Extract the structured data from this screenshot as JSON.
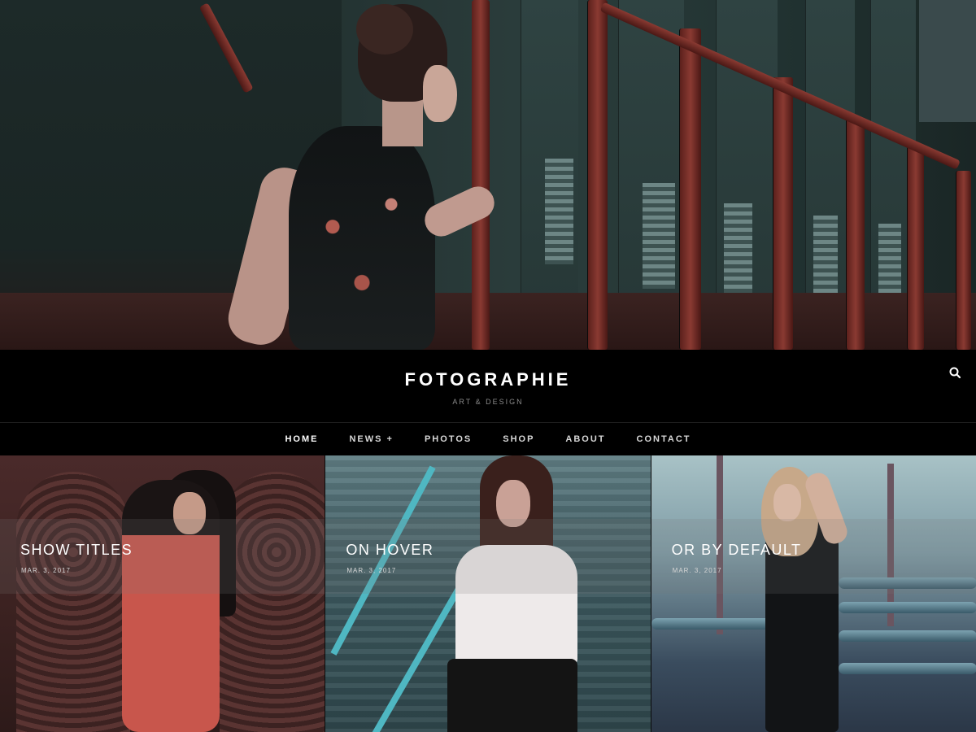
{
  "site": {
    "title": "FOTOGRAPHIE",
    "tagline": "ART & DESIGN"
  },
  "header": {
    "search_icon": "search-icon"
  },
  "nav": {
    "items": [
      {
        "label": "HOME",
        "active": true
      },
      {
        "label": "NEWS +",
        "active": false
      },
      {
        "label": "PHOTOS",
        "active": false
      },
      {
        "label": "SHOP",
        "active": false
      },
      {
        "label": "ABOUT",
        "active": false
      },
      {
        "label": "CONTACT",
        "active": false
      }
    ]
  },
  "posts": [
    {
      "title": "SHOW TITLES",
      "date": "MAR. 3, 2017"
    },
    {
      "title": "ON HOVER",
      "date": "MAR. 3, 2017"
    },
    {
      "title": "OR BY DEFAULT",
      "date": "MAR. 3, 2017"
    }
  ],
  "colors": {
    "background": "#000000",
    "text": "#ffffff",
    "muted_text": "#8a8a8a"
  }
}
